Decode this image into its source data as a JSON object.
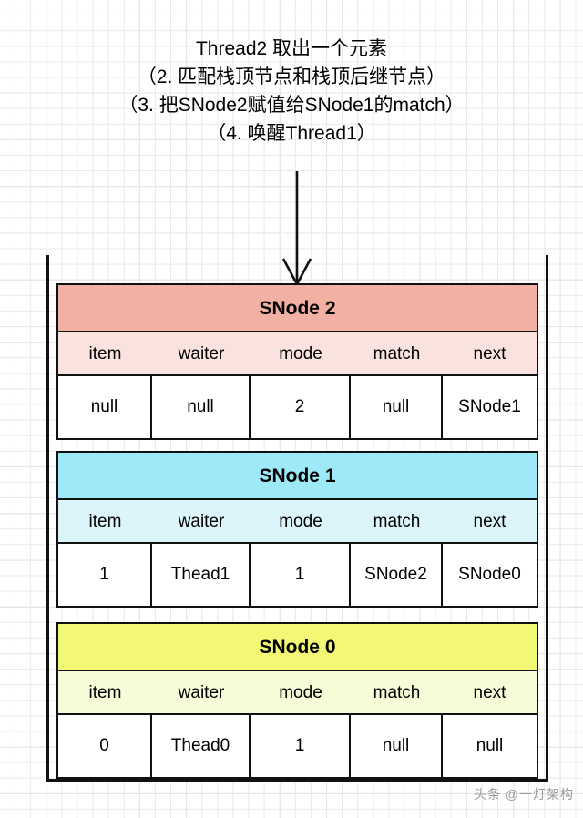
{
  "caption": {
    "lines": [
      "Thread2 取出一个元素",
      "（2. 匹配栈顶节点和栈顶后继节点）",
      "（3. 把SNode2赋值给SNode1的match）",
      "（4. 唤醒Thread1）"
    ]
  },
  "arrow": {
    "icon": "down-arrow-icon",
    "direction": "down"
  },
  "colors": {
    "snode2_title_bg": "#f2b0a2",
    "snode2_header_bg": "#fae3de",
    "snode1_title_bg": "#9ee9f7",
    "snode1_header_bg": "#dcf5fa",
    "snode0_title_bg": "#f2f775",
    "snode0_header_bg": "#f8fbd8",
    "border": "#111111",
    "grid_minor": "#e9e9e9",
    "grid_major": "#d6d6d6",
    "watermark": "#9a9a9a"
  },
  "columns": [
    "item",
    "waiter",
    "mode",
    "match",
    "next"
  ],
  "nodes": [
    {
      "title": "SNode 2",
      "headers": [
        "item",
        "waiter",
        "mode",
        "match",
        "next"
      ],
      "values": [
        "null",
        "null",
        "2",
        "null",
        "SNode1"
      ]
    },
    {
      "title": "SNode 1",
      "headers": [
        "item",
        "waiter",
        "mode",
        "match",
        "next"
      ],
      "values": [
        "1",
        "Thead1",
        "1",
        "SNode2",
        "SNode0"
      ]
    },
    {
      "title": "SNode 0",
      "headers": [
        "item",
        "waiter",
        "mode",
        "match",
        "next"
      ],
      "values": [
        "0",
        "Thead0",
        "1",
        "null",
        "null"
      ]
    }
  ],
  "watermark": {
    "text": "头条 @一灯架构"
  }
}
